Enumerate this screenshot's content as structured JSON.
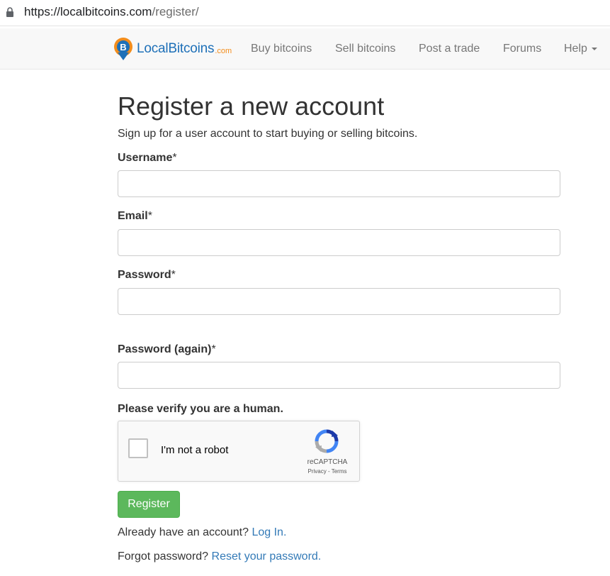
{
  "browser": {
    "url_host": "https://localbitcoins.com",
    "url_path": "/register/"
  },
  "navbar": {
    "brand": "LocalBitcoins",
    "brand_suffix": ".com",
    "items": [
      "Buy bitcoins",
      "Sell bitcoins",
      "Post a trade",
      "Forums",
      "Help"
    ]
  },
  "form": {
    "title": "Register a new account",
    "subtitle": "Sign up for a user account to start buying or selling bitcoins.",
    "required_mark": "*",
    "fields": [
      {
        "label": "Username",
        "value": ""
      },
      {
        "label": "Email",
        "value": ""
      },
      {
        "label": "Password",
        "value": ""
      },
      {
        "label": "Password (again)",
        "value": ""
      }
    ],
    "verify_label": "Please verify you are a human.",
    "submit_label": "Register"
  },
  "captcha": {
    "checkbox_label": "I'm not a robot",
    "brand": "reCAPTCHA",
    "links": "Privacy - Terms"
  },
  "footer_links": {
    "account_prompt": "Already have an account?",
    "login_link": "Log In.",
    "forgot_prompt": "Forgot password?",
    "reset_link": "Reset your password."
  },
  "colors": {
    "brand_blue": "#1e70b8",
    "brand_orange": "#f38d1c",
    "link": "#337ab7",
    "button_green": "#5cb85c"
  }
}
